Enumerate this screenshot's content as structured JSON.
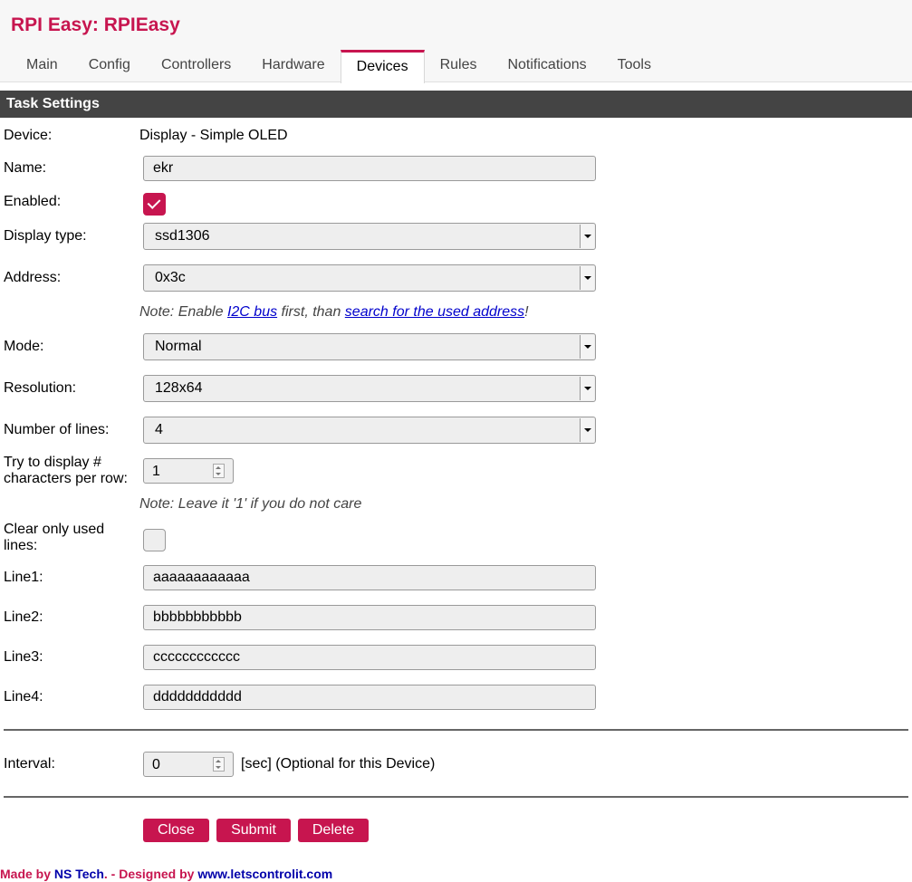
{
  "app": {
    "title": "RPI Easy: RPIEasy"
  },
  "tabs": [
    {
      "label": "Main"
    },
    {
      "label": "Config"
    },
    {
      "label": "Controllers"
    },
    {
      "label": "Hardware"
    },
    {
      "label": "Devices",
      "active": true
    },
    {
      "label": "Rules"
    },
    {
      "label": "Notifications"
    },
    {
      "label": "Tools"
    }
  ],
  "section": {
    "title": "Task Settings"
  },
  "form": {
    "device": {
      "label": "Device:",
      "value": "Display - Simple OLED"
    },
    "name": {
      "label": "Name:",
      "value": "ekr"
    },
    "enabled": {
      "label": "Enabled:",
      "checked": true
    },
    "display_type": {
      "label": "Display type:",
      "value": "ssd1306"
    },
    "address": {
      "label": "Address:",
      "value": "0x3c"
    },
    "address_note": {
      "prefix": "Note: Enable ",
      "link1": "I2C bus",
      "middle": " first, than ",
      "link2": "search for the used address",
      "suffix": "!"
    },
    "mode": {
      "label": "Mode:",
      "value": "Normal"
    },
    "resolution": {
      "label": "Resolution:",
      "value": "128x64"
    },
    "lines_count": {
      "label": "Number of lines:",
      "value": "4"
    },
    "chars_per_row": {
      "label_line1": "Try to display #",
      "label_line2": "characters per row:",
      "value": "1"
    },
    "chars_note": "Note: Leave it '1' if you do not care",
    "clear_lines": {
      "label_line1": "Clear only used",
      "label_line2": "lines:",
      "checked": false
    },
    "line1": {
      "label": "Line1:",
      "value": "aaaaaaaaaaaa"
    },
    "line2": {
      "label": "Line2:",
      "value": "bbbbbbbbbbb"
    },
    "line3": {
      "label": "Line3:",
      "value": "cccccccccccc"
    },
    "line4": {
      "label": "Line4:",
      "value": "ddddddddddd"
    },
    "interval": {
      "label": "Interval:",
      "value": "0",
      "suffix": "[sec] (Optional for this Device)"
    }
  },
  "buttons": {
    "close": "Close",
    "submit": "Submit",
    "delete": "Delete"
  },
  "footer": {
    "made_by": "Made by ",
    "brand": "NS Tech",
    "designed": ". - Designed by ",
    "site": "www.letscontrolit.com"
  },
  "colors": {
    "accent": "#c7154f",
    "section_bar": "#444444",
    "link": "#0000cc"
  }
}
